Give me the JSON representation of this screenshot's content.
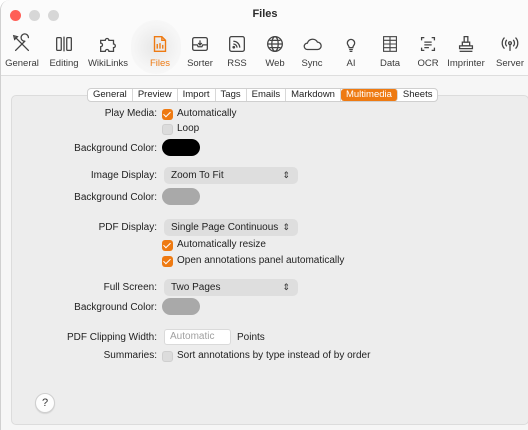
{
  "window": {
    "title": "Files"
  },
  "toolbar": {
    "items": [
      {
        "label": "General",
        "icon": "tools-icon"
      },
      {
        "label": "Editing",
        "icon": "text-cursor-icon"
      },
      {
        "label": "WikiLinks",
        "icon": "puzzle-icon"
      },
      {
        "label": "Files",
        "icon": "files-icon",
        "active": true
      },
      {
        "label": "Sorter",
        "icon": "tray-arrow-icon"
      },
      {
        "label": "RSS",
        "icon": "rss-icon"
      },
      {
        "label": "Web",
        "icon": "globe-icon"
      },
      {
        "label": "Sync",
        "icon": "cloud-icon"
      },
      {
        "label": "AI",
        "icon": "lightbulb-icon"
      },
      {
        "label": "Data",
        "icon": "data-grid-icon"
      },
      {
        "label": "OCR",
        "icon": "ocr-scan-icon"
      },
      {
        "label": "Imprinter",
        "icon": "stamp-icon"
      },
      {
        "label": "Server",
        "icon": "broadcast-icon"
      }
    ]
  },
  "tabs": [
    "General",
    "Preview",
    "Import",
    "Tags",
    "Emails",
    "Markdown",
    "Multimedia",
    "Sheets"
  ],
  "selected_tab": "Multimedia",
  "settings": {
    "play_media_label": "Play Media:",
    "automatically_label": "Automatically",
    "automatically_checked": true,
    "loop_label": "Loop",
    "loop_checked": false,
    "background_color_label": "Background Color:",
    "media_bg_color": "#000000",
    "image_display_label": "Image Display:",
    "image_display_value": "Zoom To Fit",
    "image_bg_color": "#a9a9a9",
    "pdf_display_label": "PDF Display:",
    "pdf_display_value": "Single Page Continuous",
    "auto_resize_label": "Automatically resize",
    "auto_resize_checked": true,
    "open_annotations_label": "Open annotations panel automatically",
    "open_annotations_checked": true,
    "full_screen_label": "Full Screen:",
    "full_screen_value": "Two Pages",
    "full_screen_bg_color": "#a9a9a9",
    "pdf_clipping_label": "PDF Clipping Width:",
    "pdf_clipping_placeholder": "Automatic",
    "points_label": "Points",
    "summaries_label": "Summaries:",
    "sort_annotations_label": "Sort annotations by type instead of by order",
    "sort_annotations_checked": false
  },
  "help_label": "?",
  "colors": {
    "accent": "#ee7a12"
  }
}
